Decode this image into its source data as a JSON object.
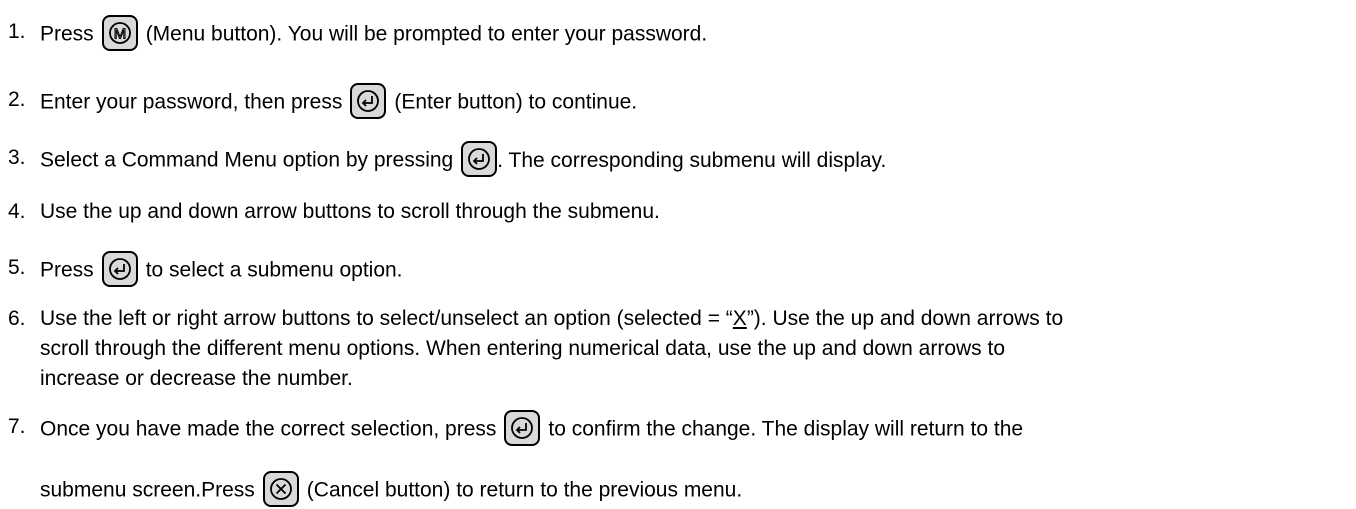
{
  "steps": [
    {
      "n": "1.",
      "a": "Press",
      "b": "(Menu button). You will be prompted to enter your password.",
      "icon": "menu-button-icon"
    },
    {
      "n": "2.",
      "a": "Enter your password, then press",
      "b": "(Enter button) to continue.",
      "icon": "enter-button-icon"
    },
    {
      "n": "3.",
      "a": "Select a Command Menu option by pressing",
      "b": ". The corresponding submenu will display.",
      "icon": "enter-button-icon"
    },
    {
      "n": "4.",
      "a": "Use the up and down arrow buttons to scroll through the submenu."
    },
    {
      "n": "5.",
      "a": "Press",
      "b": "to select a submenu option.",
      "icon": "enter-button-icon"
    },
    {
      "n": "6.",
      "a": "Use the left or right arrow buttons to select/unselect an option (selected = “",
      "x": "X",
      "c": "”). Use the up and down arrows to",
      "l2": "scroll through the different menu options. When entering numerical data, use the up and down arrows to",
      "l3": "increase or decrease the number."
    },
    {
      "n": "7.",
      "a": "Once you have made the correct selection, press",
      "b": "to confirm the change. The display will return to the",
      "l2a": "submenu screen.Press",
      "l2b": "(Cancel button) to return to the previous menu.",
      "icon": "enter-button-icon",
      "icon2": "cancel-button-icon"
    }
  ]
}
